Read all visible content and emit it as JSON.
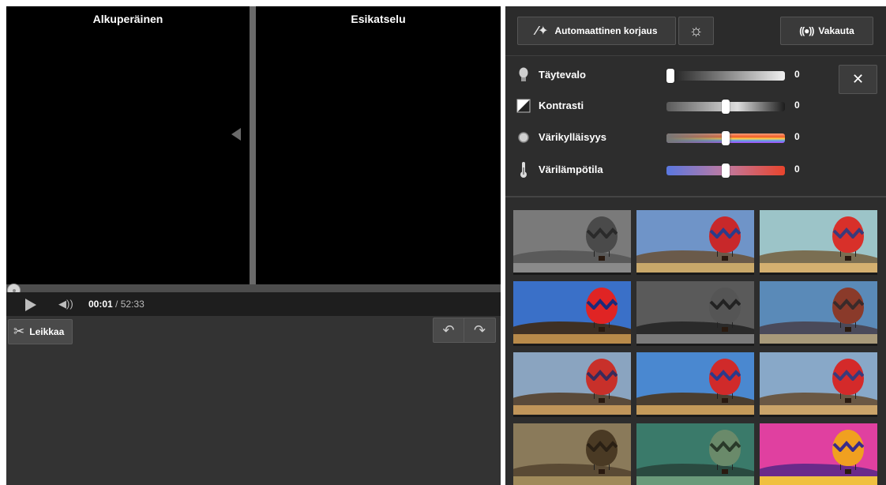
{
  "video": {
    "original_label": "Alkuperäinen",
    "preview_label": "Esikatselu",
    "time_current": "00:01",
    "time_separator": " / ",
    "time_total": "52:33"
  },
  "editor": {
    "trim_label": "Leikkaa"
  },
  "toolbar": {
    "auto_fix_label": "Automaattinen korjaus",
    "stabilize_label": "Vakauta"
  },
  "adjustments": [
    {
      "label": "Täytevalo",
      "value": "0",
      "level": 0.0,
      "icon": "lightbulb-icon"
    },
    {
      "label": "Kontrasti",
      "value": "0",
      "level": 0.5,
      "icon": "contrast-icon"
    },
    {
      "label": "Värikylläisyys",
      "value": "0",
      "level": 0.5,
      "icon": "saturation-icon"
    },
    {
      "label": "Värilämpötila",
      "value": "0",
      "level": 0.5,
      "icon": "thermometer-icon"
    }
  ],
  "filters": [
    {
      "name": "grayscale-faded",
      "sky": "#7a7a7a",
      "hill": "#5a5a5a",
      "ground": "#8a8a8a",
      "balloon": "#4a4a4a",
      "zig": "#2a2a2a"
    },
    {
      "name": "original",
      "sky": "#6f94c8",
      "hill": "#6a5a4a",
      "ground": "#c9a86a",
      "balloon": "#c8282a",
      "zig": "#2a3c8a"
    },
    {
      "name": "warm-faded",
      "sky": "#9cc4c8",
      "hill": "#7a6e52",
      "ground": "#d4b070",
      "balloon": "#d8302a",
      "zig": "#3a3a7a"
    },
    {
      "name": "vivid-vignette",
      "sky": "#3a70c8",
      "hill": "#3e3024",
      "ground": "#b88a4a",
      "balloon": "#e02424",
      "zig": "#1a2a7a"
    },
    {
      "name": "black-white-vignette",
      "sky": "#5a5a5a",
      "hill": "#2a2a2a",
      "ground": "#7a7a7a",
      "balloon": "#555555",
      "zig": "#222222"
    },
    {
      "name": "cool-blue",
      "sky": "#5a8ab8",
      "hill": "#4a4a5a",
      "ground": "#a89a7a",
      "balloon": "#8a3a2a",
      "zig": "#3a2a2a"
    },
    {
      "name": "warm-contrast",
      "sky": "#8aa4c0",
      "hill": "#5a4a3a",
      "ground": "#c0955a",
      "balloon": "#c8302a",
      "zig": "#3a2a5a"
    },
    {
      "name": "bright-blue",
      "sky": "#4a88d0",
      "hill": "#4a3e30",
      "ground": "#c49a5a",
      "balloon": "#d02a2a",
      "zig": "#2a3a8a"
    },
    {
      "name": "soft-warm",
      "sky": "#88a8c8",
      "hill": "#6a5844",
      "ground": "#caa46a",
      "balloon": "#d42a2a",
      "zig": "#3a3a7a"
    },
    {
      "name": "sepia",
      "sky": "#8a7a5a",
      "hill": "#5a4a34",
      "ground": "#a08a5a",
      "balloon": "#4a3a24",
      "zig": "#2a2014"
    },
    {
      "name": "green-tint",
      "sky": "#3a7a6a",
      "hill": "#2a4a40",
      "ground": "#6a9a7a",
      "balloon": "#6a8a6a",
      "zig": "#2a3a2a"
    },
    {
      "name": "pop-art",
      "sky": "#e040a0",
      "hill": "#6a2a8a",
      "ground": "#f0c040",
      "balloon": "#f0a020",
      "zig": "#3a2a8a"
    }
  ]
}
